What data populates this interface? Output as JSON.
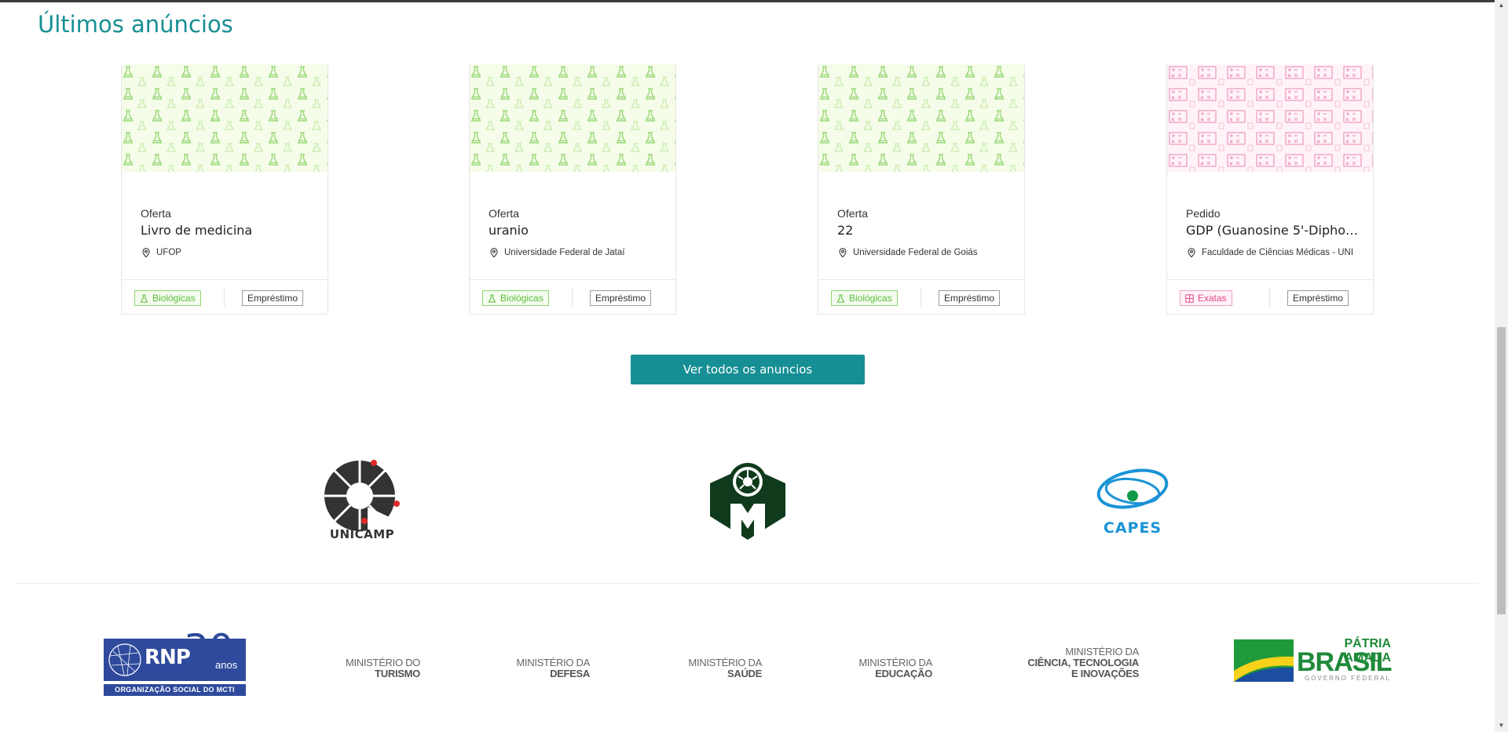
{
  "section": {
    "title": "Últimos anúncios"
  },
  "cards": [
    {
      "kind": "Oferta",
      "title": "Livro de medicina",
      "location": "UFOP",
      "area": "Biológicas",
      "type": "Empréstimo"
    },
    {
      "kind": "Oferta",
      "title": "uranio",
      "location": "Universidade Federal de Jataí",
      "area": "Biológicas",
      "type": "Empréstimo"
    },
    {
      "kind": "Oferta",
      "title": "22",
      "location": "Universidade Federal de Goiás",
      "area": "Biológicas",
      "type": "Empréstimo"
    },
    {
      "kind": "Pedido",
      "title": "GDP (Guanosine 5'-Diphos...",
      "location": "Faculdade de Ciências Médicas - UNI",
      "area": "Exatas",
      "type": "Empréstimo"
    }
  ],
  "actions": {
    "see_all": "Ver todos os anuncios"
  },
  "partners": {
    "unicamp": "UNICAMP",
    "capes": "CAPES"
  },
  "footer": {
    "rnp": {
      "name": "RNP",
      "years": "30",
      "anos": "anos",
      "tagline": "ORGANIZAÇÃO SOCIAL DO MCTI"
    },
    "turismo": {
      "line1": "MINISTÉRIO DO",
      "line2": "TURISMO"
    },
    "defesa": {
      "line1": "MINISTÉRIO DA",
      "line2": "DEFESA"
    },
    "saude": {
      "line1": "MINISTÉRIO DA",
      "line2": "SAÚDE"
    },
    "educacao": {
      "line1": "MINISTÉRIO DA",
      "line2": "EDUCAÇÃO"
    },
    "ciencia": {
      "line1": "MINISTÉRIO DA",
      "line2": "CIÊNCIA, TECNOLOGIA",
      "line3": "E INOVAÇÕES"
    },
    "brasil": {
      "line1": "PÁTRIA AMADA",
      "line2": "BRASIL",
      "line3": "GOVERNO FEDERAL"
    }
  },
  "colors": {
    "accent": "#178f93",
    "bio": "#5cbf3a",
    "exatas": "#e24b8d"
  }
}
